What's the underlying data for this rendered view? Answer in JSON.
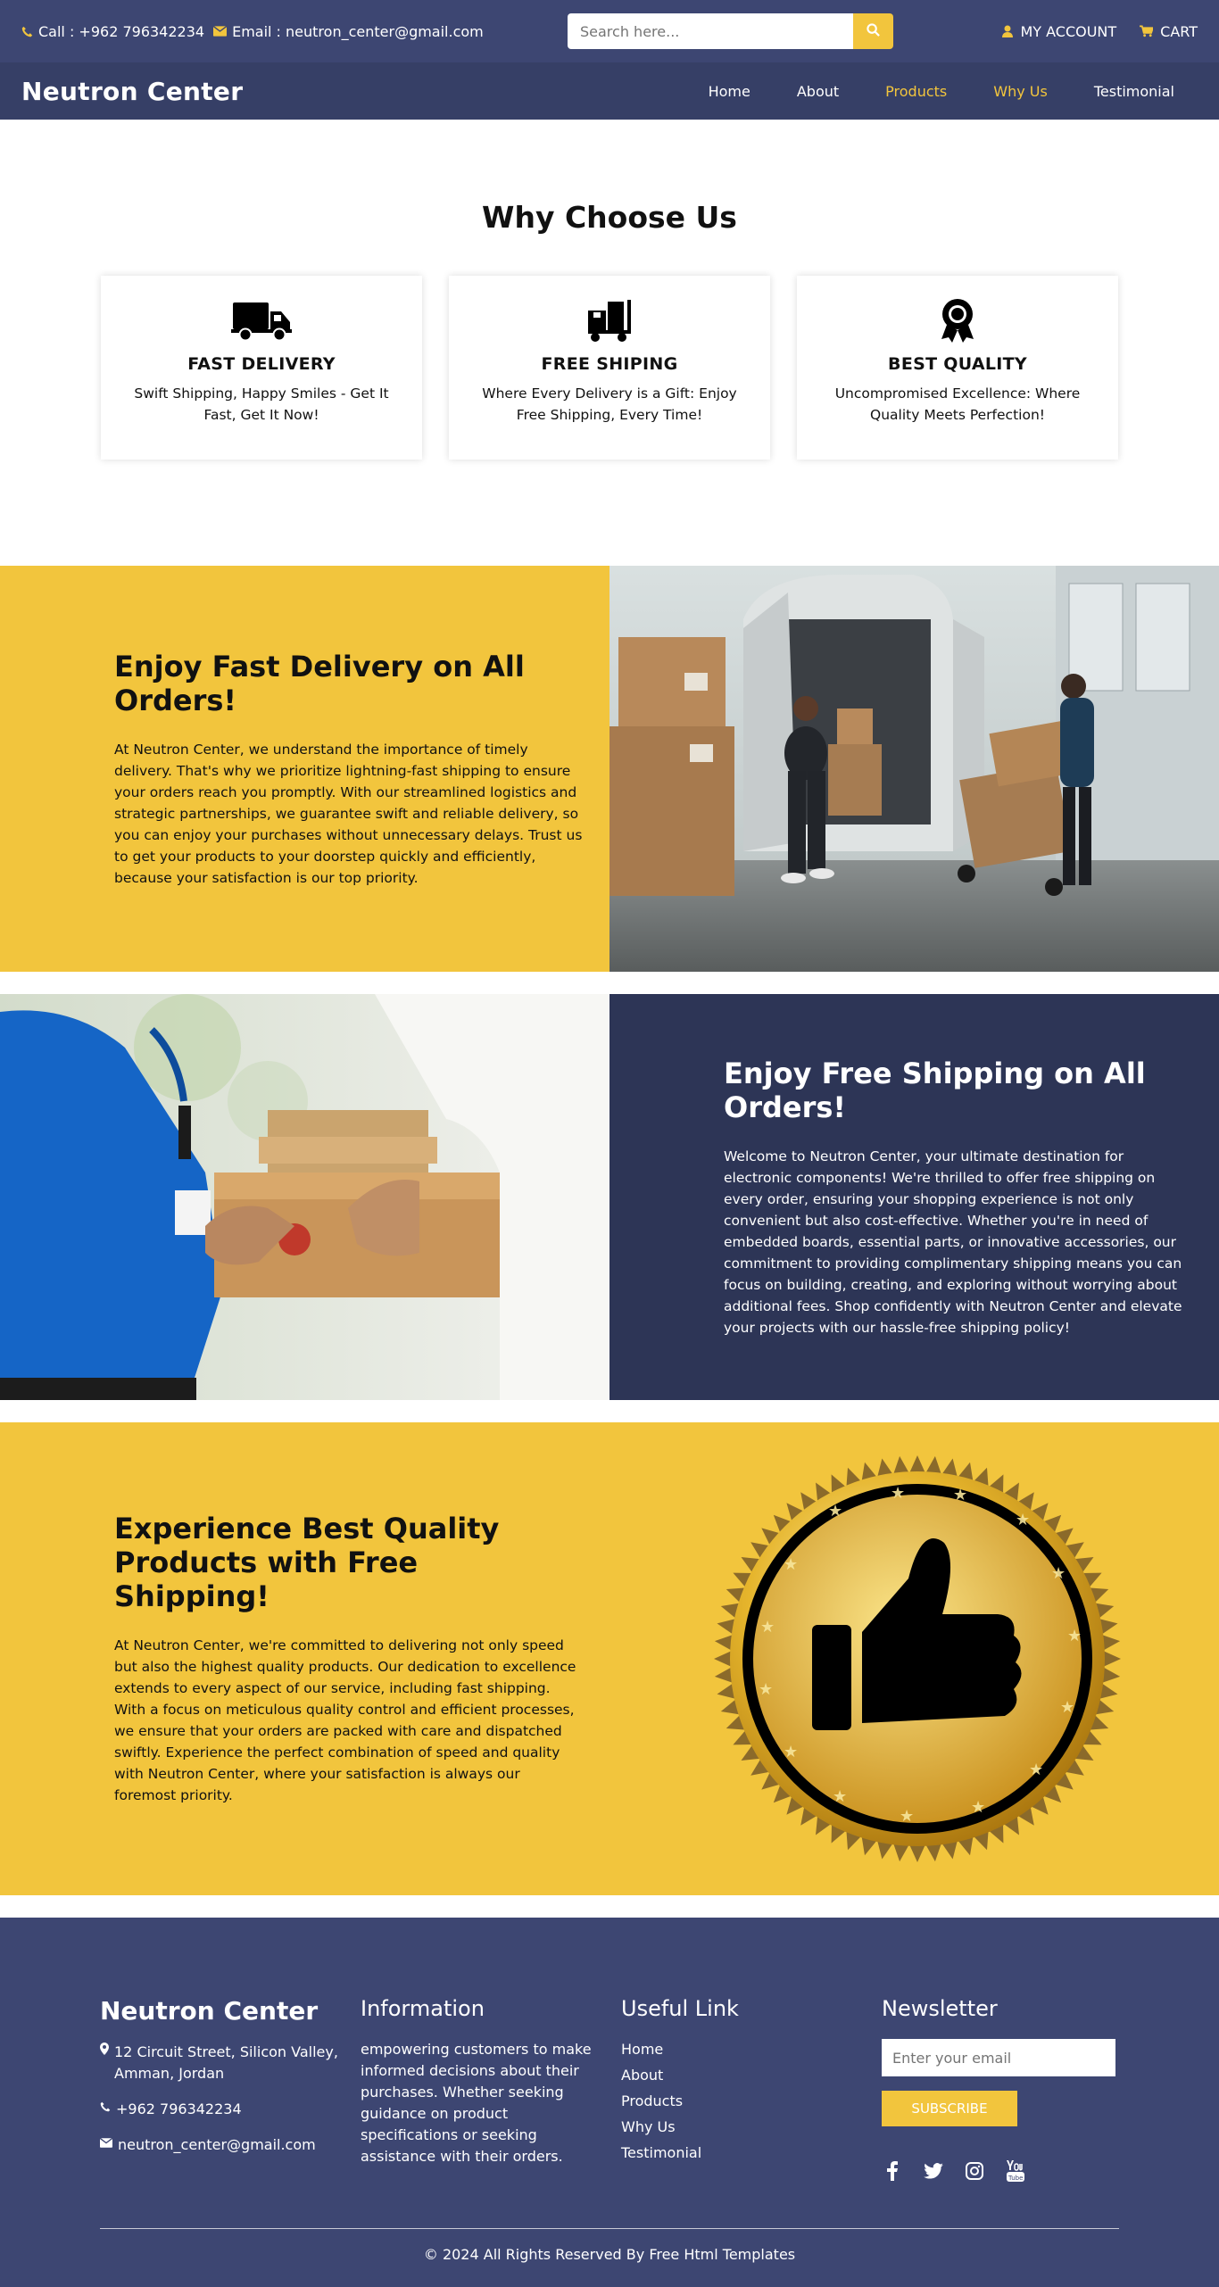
{
  "topbar": {
    "call": "Call : +962 796342234",
    "email": "Email : neutron_center@gmail.com",
    "search_placeholder": "Search here...",
    "account": "MY ACCOUNT",
    "cart": "CART"
  },
  "nav": {
    "brand": "Neutron Center",
    "items": [
      "Home",
      "About",
      "Products",
      "Why Us",
      "Testimonial"
    ]
  },
  "why": {
    "title": "Why Choose Us",
    "cards": [
      {
        "title": "FAST DELIVERY",
        "text": "Swift Shipping, Happy Smiles - Get It Fast, Get It Now!",
        "icon": "truck-icon"
      },
      {
        "title": "FREE SHIPING",
        "text": "Where Every Delivery is a Gift: Enjoy Free Shipping, Every Time!",
        "icon": "dolly-icon"
      },
      {
        "title": "BEST QUALITY",
        "text": "Uncompromised Excellence: Where Quality Meets Perfection!",
        "icon": "award-icon"
      }
    ]
  },
  "sections": {
    "fast": {
      "title": "Enjoy Fast Delivery on All Orders!",
      "text": "At Neutron Center, we understand the importance of timely delivery. That's why we prioritize lightning-fast shipping to ensure your orders reach you promptly. With our streamlined logistics and strategic partnerships, we guarantee swift and reliable delivery, so you can enjoy your purchases without unnecessary delays. Trust us to get your products to your doorstep quickly and efficiently, because your satisfaction is our top priority."
    },
    "free": {
      "title": "Enjoy Free Shipping on All Orders!",
      "text": "Welcome to Neutron Center, your ultimate destination for electronic components! We're thrilled to offer free shipping on every order, ensuring your shopping experience is not only convenient but also cost-effective. Whether you're in need of embedded boards, essential parts, or innovative accessories, our commitment to providing complimentary shipping means you can focus on building, creating, and exploring without worrying about additional fees. Shop confidently with Neutron Center and elevate your projects with our hassle-free shipping policy!"
    },
    "quality": {
      "title": "Experience Best Quality Products with Free Shipping!",
      "text": "At Neutron Center, we're committed to delivering not only speed but also the highest quality products. Our dedication to excellence extends to every aspect of our service, including fast shipping. With a focus on meticulous quality control and efficient processes, we ensure that your orders are packed with care and dispatched swiftly. Experience the perfect combination of speed and quality with Neutron Center, where your satisfaction is always our foremost priority."
    }
  },
  "footer": {
    "brand": "Neutron Center",
    "address": "12 Circuit Street, Silicon Valley, Amman, Jordan",
    "phone": "+962 796342234",
    "email": "neutron_center@gmail.com",
    "info_title": "Information",
    "info_text": "empowering customers to make informed decisions about their purchases. Whether seeking guidance on product specifications or seeking assistance with their orders.",
    "links_title": "Useful Link",
    "links": [
      "Home",
      "About",
      "Products",
      "Why Us",
      "Testimonial"
    ],
    "newsletter_title": "Newsletter",
    "email_placeholder": "Enter your email",
    "subscribe": "SUBSCRIBE",
    "copyright": "© 2024 All Rights Reserved By Free Html Templates"
  },
  "colors": {
    "accent": "#f2c53d",
    "navy": "#3d4672",
    "navy_dark": "#2d3556"
  }
}
